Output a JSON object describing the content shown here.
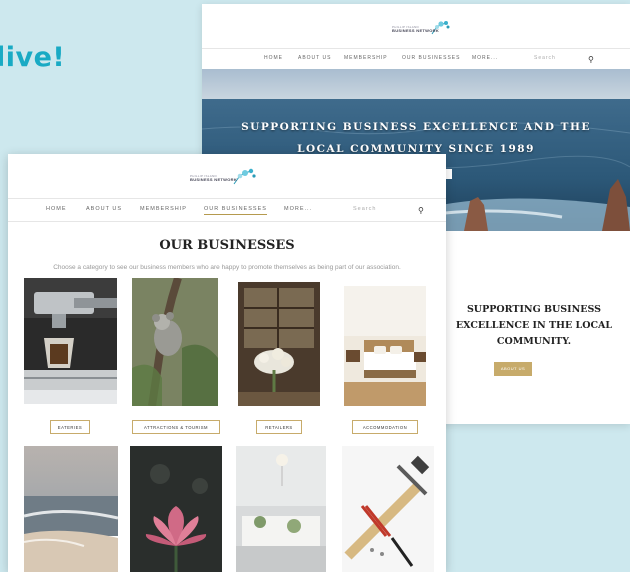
{
  "headline": "live!",
  "brand": {
    "name_line1": "PHILLIP ISLAND",
    "name_line2": "BUSINESS NETWORK"
  },
  "nav": {
    "items": [
      "HOME",
      "ABOUT US",
      "MEMBERSHIP",
      "OUR BUSINESSES",
      "MORE..."
    ],
    "search_placeholder": "Search",
    "active": "OUR BUSINESSES"
  },
  "home_page": {
    "hero_line1": "SUPPORTING BUSINESS EXCELLENCE AND THE",
    "hero_line2": "LOCAL COMMUNITY SINCE 1989",
    "tagline_line1": "SUPPORTING BUSINESS",
    "tagline_line2": "EXCELLENCE IN THE LOCAL",
    "tagline_line3": "COMMUNITY.",
    "about_button": "ABOUT US"
  },
  "businesses_page": {
    "title": "OUR BUSINESSES",
    "subtitle": "Choose a category to see our business members who are happy to promote themselves as being part of our association.",
    "categories": [
      "EATERIES",
      "ATTRACTIONS & TOURISM",
      "RETAILERS",
      "ACCOMMODATION"
    ]
  },
  "colors": {
    "accent_teal": "#19aac4",
    "gold": "#c7ab6b",
    "background": "#cde8ee"
  }
}
